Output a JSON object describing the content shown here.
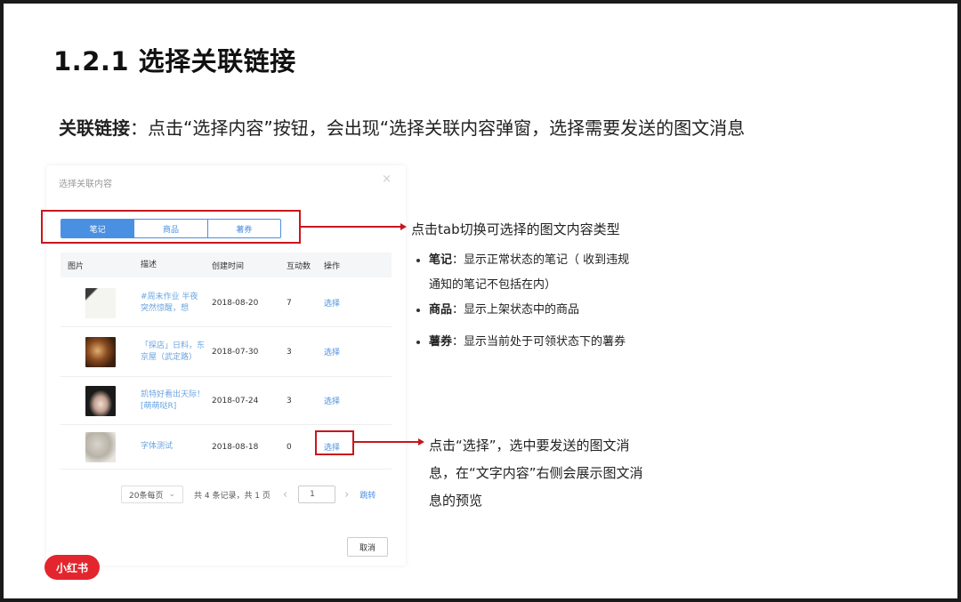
{
  "title": "1.2.1 选择关联链接",
  "intro": {
    "label": "关联链接",
    "colon": "：",
    "text": "点击“选择内容”按钮，会出现“选择关联内容弹窗，选择需要发送的图文消息"
  },
  "dialog": {
    "title": "选择关联内容",
    "close": "×",
    "tabs": [
      {
        "label": "笔记",
        "active": true
      },
      {
        "label": "商品",
        "active": false
      },
      {
        "label": "薯券",
        "active": false
      }
    ],
    "columns": [
      "图片",
      "描述",
      "创建时间",
      "互动数",
      "操作"
    ],
    "rows": [
      {
        "desc": "#周末作业 半夜突然惊醒，想",
        "date": "2018-08-20",
        "count": "7",
        "action": "选择"
      },
      {
        "desc": "「探店」日料，东京屋（武定路）",
        "date": "2018-07-30",
        "count": "3",
        "action": "选择"
      },
      {
        "desc": "凯特好看出天际！[萌萌哒R]",
        "date": "2018-07-24",
        "count": "3",
        "action": "选择"
      },
      {
        "desc": "字体测试",
        "date": "2018-08-18",
        "count": "0",
        "action": "选择"
      }
    ],
    "pager": {
      "page_size": "20条每页",
      "summary": "共 4 条记录，共 1 页",
      "prev": "‹",
      "page": "1",
      "next": "›",
      "jump": "跳转"
    },
    "cancel": "取消"
  },
  "annotation_tab": {
    "text": "点击tab切换可选择的图文内容类型",
    "bullets": [
      {
        "label": "笔记",
        "text": "：显示正常状态的笔记（ 收到违规",
        "cont": "通知的笔记不包括在内）"
      },
      {
        "label": "商品",
        "text": "：显示上架状态中的商品"
      },
      {
        "label": "薯券",
        "text": "：显示当前处于可领状态下的薯券"
      }
    ]
  },
  "annotation_select": {
    "lines": [
      "点击“选择”，选中要发送的图文消",
      "息，在“文字内容”右侧会展示图文消",
      "息的预览"
    ]
  },
  "logo": "小红书",
  "colors": {
    "accent": "#4a90e2",
    "highlight": "#c8161d",
    "brand": "#e3262e"
  }
}
